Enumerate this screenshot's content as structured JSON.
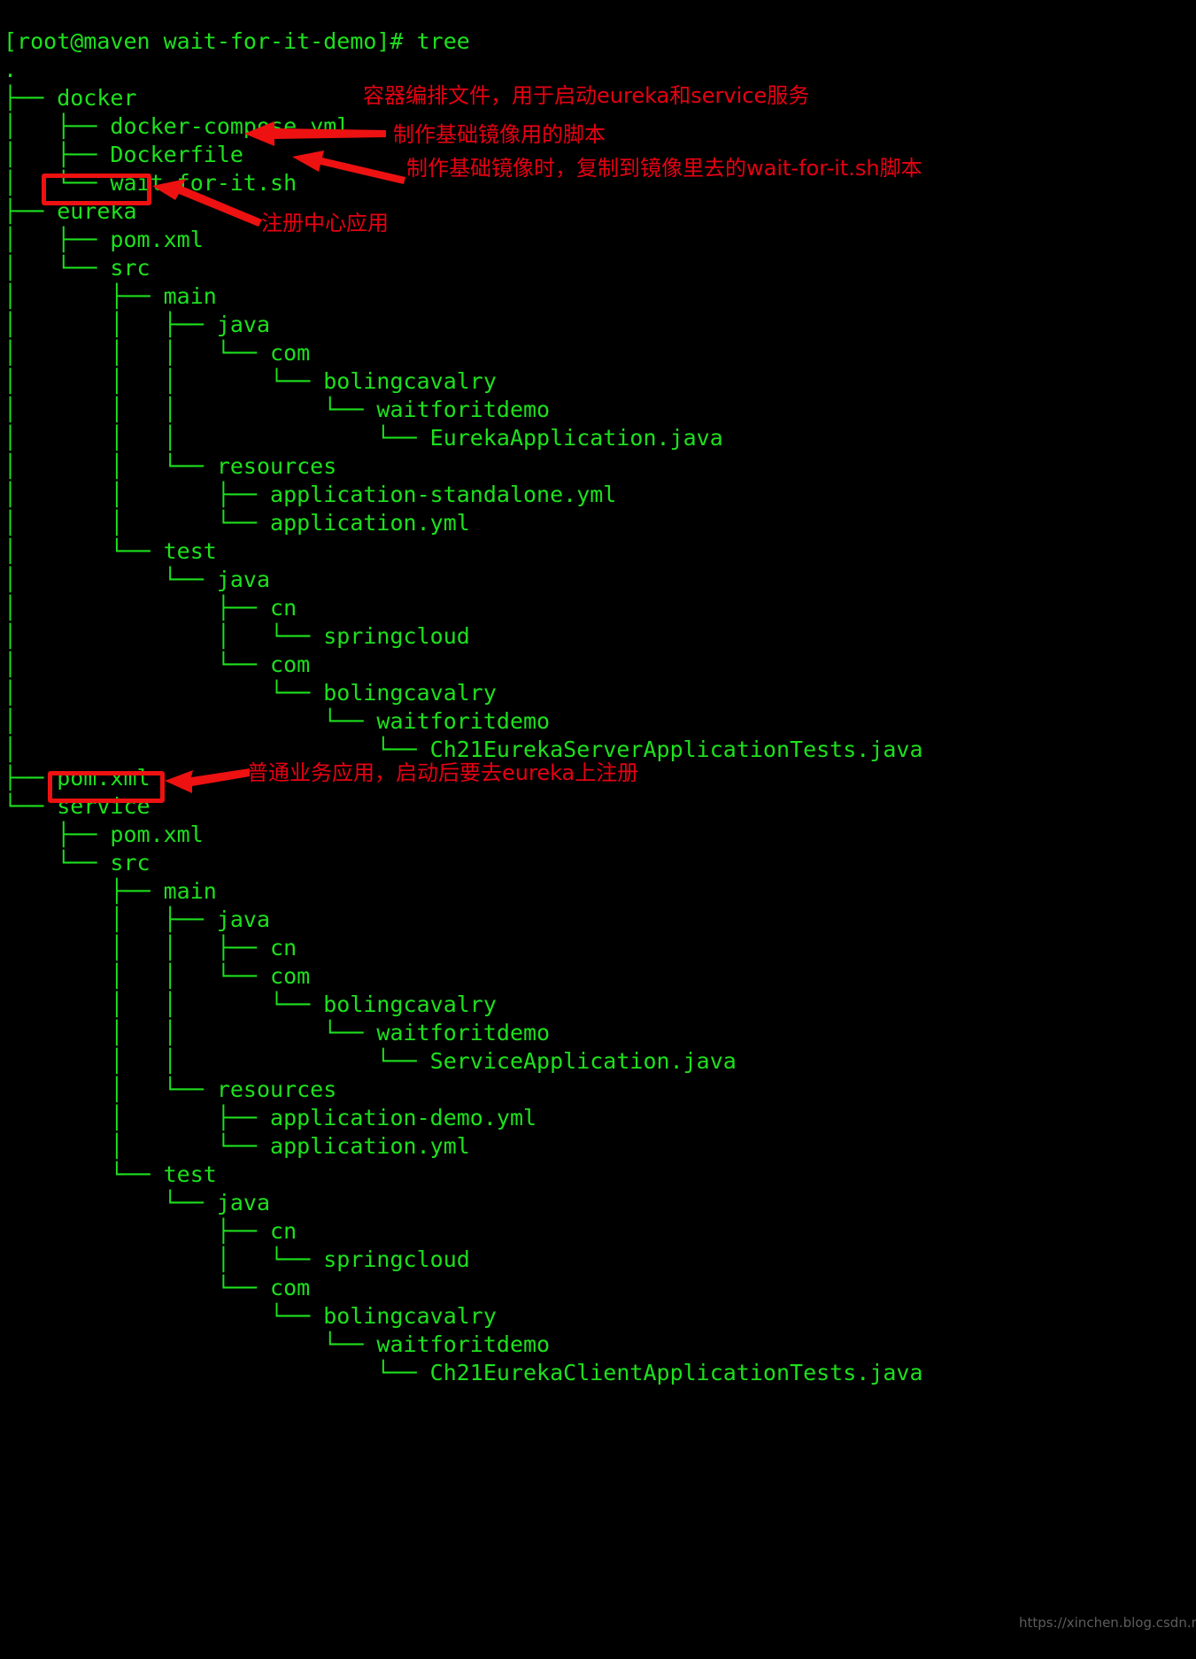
{
  "terminal": {
    "prompt_line": "[root@maven wait-for-it-demo]# tree",
    "root": ".",
    "lines": [
      "[root@maven wait-for-it-demo]# tree",
      ".",
      "├── docker",
      "│   ├── docker-compose.yml",
      "│   ├── Dockerfile",
      "│   └── wait-for-it.sh",
      "├── eureka",
      "│   ├── pom.xml",
      "│   └── src",
      "│       ├── main",
      "│       │   ├── java",
      "│       │   │   └── com",
      "│       │   │       └── bolingcavalry",
      "│       │   │           └── waitforitdemo",
      "│       │   │               └── EurekaApplication.java",
      "│       │   └── resources",
      "│       │       ├── application-standalone.yml",
      "│       │       └── application.yml",
      "│       └── test",
      "│           └── java",
      "│               ├── cn",
      "│               │   └── springcloud",
      "│               └── com",
      "│                   └── bolingcavalry",
      "│                       └── waitforitdemo",
      "│                           └── Ch21EurekaServerApplicationTests.java",
      "├── pom.xml",
      "└── service",
      "    ├── pom.xml",
      "    └── src",
      "        ├── main",
      "        │   ├── java",
      "        │   │   ├── cn",
      "        │   │   └── com",
      "        │   │       └── bolingcavalry",
      "        │   │           └── waitforitdemo",
      "        │   │               └── ServiceApplication.java",
      "        │   └── resources",
      "        │       ├── application-demo.yml",
      "        │       └── application.yml",
      "        └── test",
      "            └── java",
      "                ├── cn",
      "                │   └── springcloud",
      "                └── com",
      "                    └── bolingcavalry",
      "                        └── waitforitdemo",
      "                            └── Ch21EurekaClientApplicationTests.java"
    ]
  },
  "annotations": [
    {
      "id": "docker-compose-note",
      "text": "容器编排文件，用于启动eureka和service服务"
    },
    {
      "id": "dockerfile-note",
      "text": "制作基础镜像用的脚本"
    },
    {
      "id": "wait-for-it-note",
      "text": "制作基础镜像时，复制到镜像里去的wait-for-it.sh脚本"
    },
    {
      "id": "eureka-note",
      "text": "注册中心应用"
    },
    {
      "id": "service-note",
      "text": "普通业务应用，启动后要去eureka上注册"
    }
  ],
  "highlights": [
    {
      "id": "eureka-highlight",
      "label": "eureka"
    },
    {
      "id": "service-highlight",
      "label": "service"
    }
  ],
  "watermark": {
    "text": "https://xinchen.blog.csdn.net"
  },
  "colors": {
    "background": "#000000",
    "terminal_green": "#1ee01e",
    "annotation_red": "#e60012",
    "highlight_red": "#ee1111"
  }
}
